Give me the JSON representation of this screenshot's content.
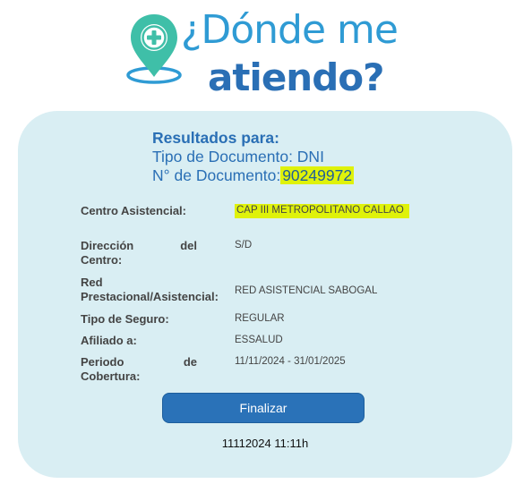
{
  "header": {
    "title_line1": "¿Dónde me",
    "title_line2": "atiendo?",
    "logo_icon": "location-pin-plus-icon"
  },
  "results": {
    "heading": "Resultados para:",
    "doc_type": "Tipo de Documento: DNI",
    "doc_number_label": "N° de Documento:",
    "doc_number": "90249972"
  },
  "details": {
    "centro_label": "Centro Asistencial:",
    "centro_value": "CAP III METROPOLITANO CALLAO",
    "direccion_label": "Dirección del Centro:",
    "direccion_value": "S/D",
    "red_label": "Red Prestacional/Asistencial:",
    "red_value": "RED ASISTENCIAL SABOGAL",
    "seguro_label": "Tipo de Seguro:",
    "seguro_value": "REGULAR",
    "afiliado_label": "Afiliado a:",
    "afiliado_value": "ESSALUD",
    "periodo_label": "Periodo de Cobertura:",
    "periodo_value": "11/11/2024 - 31/01/2025"
  },
  "actions": {
    "finalize_label": "Finalizar"
  },
  "timestamp": "11112024 11:11h",
  "colors": {
    "accent_blue": "#2a6fb5",
    "light_blue": "#2f9bd4",
    "teal": "#3fbfa8",
    "highlight": "#dff20a",
    "card_bg": "#d9eef3"
  }
}
